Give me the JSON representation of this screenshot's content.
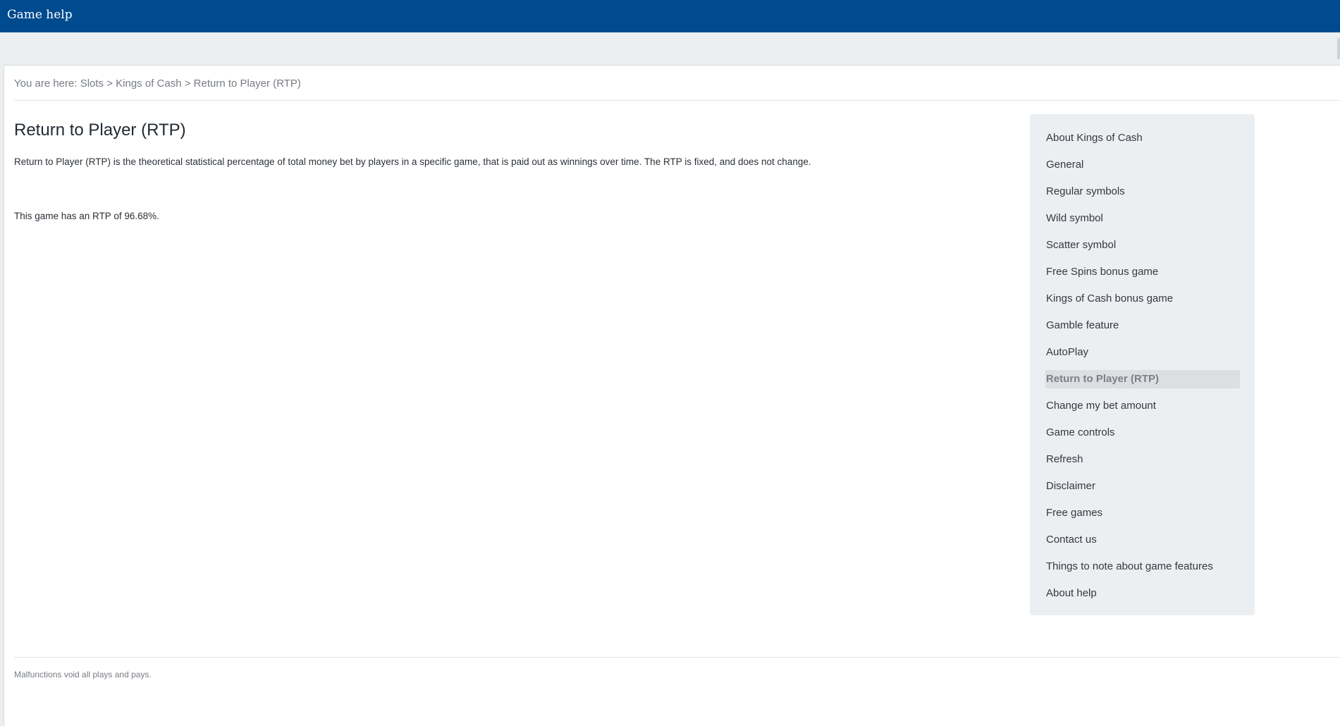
{
  "window": {
    "title": "Game help"
  },
  "breadcrumb": {
    "prefix": "You are here: ",
    "items": [
      "Slots",
      "Kings of Cash",
      "Return to Player (RTP)"
    ],
    "separator": " > "
  },
  "main": {
    "heading": "Return to Player (RTP)",
    "paragraphs": [
      "Return to Player (RTP) is the theoretical statistical percentage of total money bet by players in a specific game, that is paid out as winnings over time. The RTP is fixed, and does not change.",
      "This game has an RTP of 96.68%."
    ]
  },
  "sidebar": {
    "items": [
      {
        "label": "About Kings of Cash"
      },
      {
        "label": "General"
      },
      {
        "label": "Regular symbols"
      },
      {
        "label": "Wild symbol"
      },
      {
        "label": "Scatter symbol"
      },
      {
        "label": "Free Spins bonus game"
      },
      {
        "label": "Kings of Cash bonus game"
      },
      {
        "label": "Gamble feature"
      },
      {
        "label": "AutoPlay"
      },
      {
        "label": "Return to Player (RTP)",
        "active": true
      },
      {
        "label": "Change my bet amount"
      },
      {
        "label": "Game controls"
      },
      {
        "label": "Refresh"
      },
      {
        "label": "Disclaimer"
      },
      {
        "label": "Free games"
      },
      {
        "label": "Contact us"
      },
      {
        "label": "Things to note about game features"
      },
      {
        "label": "About help"
      }
    ]
  },
  "footer": {
    "text": "Malfunctions void all plays and pays."
  },
  "colors": {
    "header_bg": "#004a8f",
    "page_bg": "#eceff2",
    "content_bg": "#ffffff",
    "sidebar_active_bg": "#dcdfe2"
  }
}
